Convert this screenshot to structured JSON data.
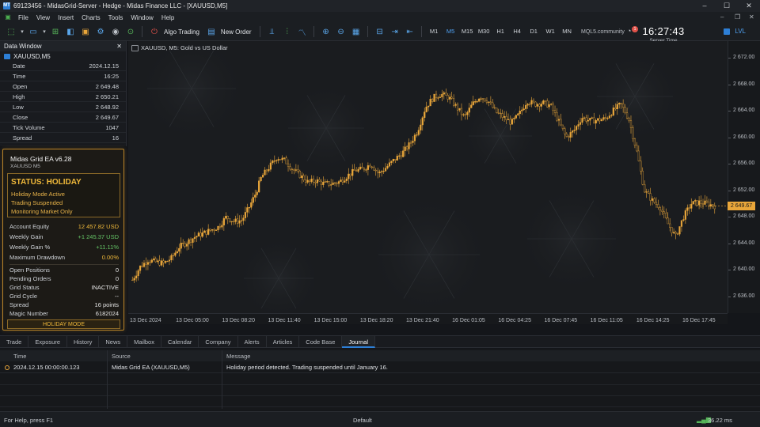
{
  "window": {
    "title": "69123456 - MidasGrid-Server - Hedge - Midas Finance LLC - [XAUUSD,M5]",
    "controls": {
      "minimize": "–",
      "maximize": "☐",
      "close": "✕"
    },
    "mdi_controls": {
      "minimize": "–",
      "restore": "❐",
      "close": "✕"
    }
  },
  "menu": {
    "items": [
      "File",
      "View",
      "Insert",
      "Charts",
      "Tools",
      "Window",
      "Help"
    ]
  },
  "toolbar": {
    "algo_trading": "Algo Trading",
    "new_order": "New Order",
    "timeframes": [
      "M1",
      "M5",
      "M15",
      "M30",
      "H1",
      "H4",
      "D1",
      "W1",
      "MN"
    ],
    "active_timeframe": "M5",
    "community": "MQL5.community",
    "notification_count": "1",
    "server_time": "16:27:43",
    "server_time_label": "Server Time",
    "lvl_label": "LVL"
  },
  "data_window": {
    "title": "Data Window",
    "close": "✕",
    "symbol": "XAUUSD,M5",
    "rows": [
      {
        "key": "Date",
        "value": "2024.12.15"
      },
      {
        "key": "Time",
        "value": "16:25"
      },
      {
        "key": "Open",
        "value": "2 649.48"
      },
      {
        "key": "High",
        "value": "2 650.21"
      },
      {
        "key": "Low",
        "value": "2 648.92"
      },
      {
        "key": "Close",
        "value": "2 649.67"
      },
      {
        "key": "Tick Volume",
        "value": "1047"
      },
      {
        "key": "Spread",
        "value": "16"
      }
    ]
  },
  "ea_panel": {
    "title": "Midas Grid EA v6.28",
    "subtitle": "XAUUSD M5",
    "status_title": "STATUS: HOLIDAY",
    "status_lines": [
      "Holiday Mode Active",
      "Trading Suspended",
      "Monitoring Market Only"
    ],
    "metrics": [
      {
        "key": "Account Equity",
        "value": "12 457.82 USD"
      },
      {
        "key": "Weekly Gain",
        "value": "+1 245.37 USD"
      },
      {
        "key": "Weekly Gain %",
        "value": "+11.11%"
      },
      {
        "key": "Maximum Drawdown",
        "value": "0.00%"
      }
    ],
    "details": [
      {
        "key": "Open Positions",
        "value": "0"
      },
      {
        "key": "Pending Orders",
        "value": "0"
      },
      {
        "key": "Grid Status",
        "value": "INACTIVE"
      },
      {
        "key": "Grid Cycle",
        "value": "--"
      },
      {
        "key": "Spread",
        "value": "16 points"
      },
      {
        "key": "Magic Number",
        "value": "6182024"
      }
    ],
    "mode_button": "HOLIDAY MODE",
    "colors": {
      "accent": "#f0b93a",
      "gain": "#65c466"
    }
  },
  "chart": {
    "label": "XAUUSD, M5:  Gold vs US Dollar",
    "current_price": "2 649.67"
  },
  "chart_data": {
    "type": "candlestick",
    "symbol": "XAUUSD",
    "timeframe": "M5",
    "y_ticks": [
      "2 672.00",
      "2 668.00",
      "2 664.00",
      "2 660.00",
      "2 656.00",
      "2 652.00",
      "2 648.00",
      "2 644.00",
      "2 640.00",
      "2 636.00"
    ],
    "x_ticks": [
      "13 Dec 2024",
      "13 Dec 05:00",
      "13 Dec 08:20",
      "13 Dec 11:40",
      "13 Dec 15:00",
      "13 Dec 18:20",
      "13 Dec 21:40",
      "16 Dec 01:05",
      "16 Dec 04:25",
      "16 Dec 07:45",
      "16 Dec 11:05",
      "16 Dec 14:25",
      "16 Dec 17:45"
    ],
    "ylim": [
      2633.5,
      2674.5
    ],
    "close_path_keypoints": [
      [
        0,
        2638.5
      ],
      [
        4,
        2640.5
      ],
      [
        8,
        2641.5
      ],
      [
        12,
        2641.2
      ],
      [
        16,
        2641.0
      ],
      [
        20,
        2641.8
      ],
      [
        24,
        2643.5
      ],
      [
        28,
        2644.2
      ],
      [
        32,
        2645.0
      ],
      [
        36,
        2645.5
      ],
      [
        40,
        2646.0
      ],
      [
        44,
        2646.5
      ],
      [
        48,
        2648.0
      ],
      [
        52,
        2647.3
      ],
      [
        56,
        2647.5
      ],
      [
        60,
        2649.6
      ],
      [
        63,
        2651.5
      ],
      [
        66,
        2654.0
      ],
      [
        70,
        2655.5
      ],
      [
        74,
        2657.0
      ],
      [
        78,
        2656.5
      ],
      [
        82,
        2655.2
      ],
      [
        86,
        2654.2
      ],
      [
        90,
        2653.2
      ],
      [
        94,
        2653.5
      ],
      [
        98,
        2653.0
      ],
      [
        102,
        2653.0
      ],
      [
        106,
        2653.3
      ],
      [
        110,
        2654.2
      ],
      [
        114,
        2655.0
      ],
      [
        118,
        2655.2
      ],
      [
        122,
        2656.0
      ],
      [
        126,
        2654.5
      ],
      [
        130,
        2655.5
      ],
      [
        134,
        2656.6
      ],
      [
        138,
        2657.6
      ],
      [
        142,
        2659.0
      ],
      [
        146,
        2661.0
      ],
      [
        150,
        2664.5
      ],
      [
        154,
        2666.0
      ],
      [
        158,
        2666.5
      ],
      [
        162,
        2666.0
      ],
      [
        166,
        2664.5
      ],
      [
        170,
        2663.0
      ],
      [
        174,
        2665.0
      ],
      [
        178,
        2666.2
      ],
      [
        182,
        2665.5
      ],
      [
        186,
        2663.8
      ],
      [
        190,
        2663.0
      ],
      [
        194,
        2662.2
      ],
      [
        198,
        2663.5
      ],
      [
        202,
        2665.5
      ],
      [
        206,
        2665.0
      ],
      [
        210,
        2665.2
      ],
      [
        214,
        2664.8
      ],
      [
        218,
        2662.5
      ],
      [
        222,
        2660.0
      ],
      [
        226,
        2661.0
      ],
      [
        230,
        2663.0
      ],
      [
        234,
        2662.5
      ],
      [
        238,
        2662.6
      ],
      [
        242,
        2662.8
      ],
      [
        246,
        2664.0
      ],
      [
        250,
        2665.0
      ],
      [
        254,
        2662.8
      ],
      [
        258,
        2658.0
      ],
      [
        262,
        2652.0
      ],
      [
        266,
        2650.5
      ],
      [
        270,
        2649.5
      ],
      [
        274,
        2647.0
      ],
      [
        278,
        2645.0
      ],
      [
        282,
        2648.0
      ],
      [
        286,
        2650.0
      ],
      [
        290,
        2650.2
      ],
      [
        294,
        2650.0
      ],
      [
        298,
        2649.67
      ]
    ],
    "candle_count": 300,
    "colors": {
      "candle": "#e9a63a",
      "background": "#1a1c1f"
    },
    "grid": false
  },
  "bottom_tabs": {
    "items": [
      "Trade",
      "Exposure",
      "History",
      "News",
      "Mailbox",
      "Calendar",
      "Company",
      "Alerts",
      "Articles",
      "Code Base",
      "Journal"
    ],
    "active": "Journal"
  },
  "journal": {
    "columns": [
      "Time",
      "Source",
      "Message"
    ],
    "rows": [
      {
        "time": "2024.12.15 00:00:00.123",
        "source": "Midas Grid EA (XAUUSD,M5)",
        "message": "Holiday period detected. Trading suspended until January 16."
      }
    ]
  },
  "statusbar": {
    "help": "For Help, press F1",
    "profile": "Default",
    "ping": "36.22 ms"
  }
}
